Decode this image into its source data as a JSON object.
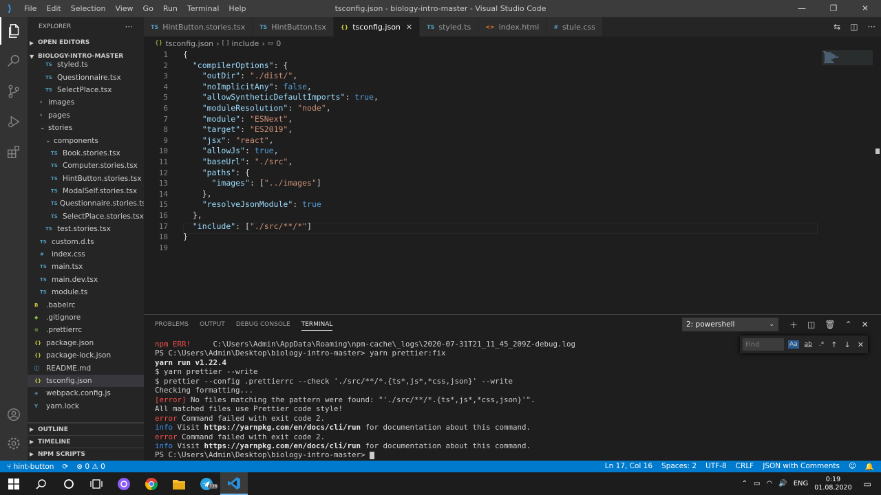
{
  "titlebar": {
    "menus": [
      "File",
      "Edit",
      "Selection",
      "View",
      "Go",
      "Run",
      "Terminal",
      "Help"
    ],
    "title": "tsconfig.json - biology-intro-master - Visual Studio Code"
  },
  "explorer": {
    "header": "EXPLORER",
    "open_editors": "OPEN EDITORS",
    "root": "BIOLOGY-INTRO-MASTER",
    "items": [
      {
        "label": "styled.ts",
        "type": "ts",
        "indent": 2
      },
      {
        "label": "Questionnaire.tsx",
        "type": "ts",
        "indent": 2
      },
      {
        "label": "SelectPlace.tsx",
        "type": "ts",
        "indent": 2
      },
      {
        "label": "images",
        "type": "folder",
        "indent": 1
      },
      {
        "label": "pages",
        "type": "folder",
        "indent": 1
      },
      {
        "label": "stories",
        "type": "folder-open",
        "indent": 1
      },
      {
        "label": "components",
        "type": "folder-open",
        "indent": 2
      },
      {
        "label": "Book.stories.tsx",
        "type": "ts",
        "indent": 3
      },
      {
        "label": "Computer.stories.tsx",
        "type": "ts",
        "indent": 3
      },
      {
        "label": "HintButton.stories.tsx",
        "type": "ts",
        "indent": 3
      },
      {
        "label": "ModalSelf.stories.tsx",
        "type": "ts",
        "indent": 3
      },
      {
        "label": "Questionnaire.stories.tsx",
        "type": "ts",
        "indent": 3
      },
      {
        "label": "SelectPlace.stories.tsx",
        "type": "ts",
        "indent": 3
      },
      {
        "label": "test.stories.tsx",
        "type": "ts",
        "indent": 2
      },
      {
        "label": "custom.d.ts",
        "type": "ts",
        "indent": 1
      },
      {
        "label": "index.css",
        "type": "css",
        "indent": 1
      },
      {
        "label": "main.tsx",
        "type": "ts",
        "indent": 1
      },
      {
        "label": "main.dev.tsx",
        "type": "ts",
        "indent": 1
      },
      {
        "label": "module.ts",
        "type": "ts",
        "indent": 1
      },
      {
        "label": ".babelrc",
        "type": "babel",
        "indent": 0
      },
      {
        "label": ".gitignore",
        "type": "git",
        "indent": 0
      },
      {
        "label": ".prettierrc",
        "type": "prettier",
        "indent": 0
      },
      {
        "label": "package.json",
        "type": "json",
        "indent": 0
      },
      {
        "label": "package-lock.json",
        "type": "json",
        "indent": 0
      },
      {
        "label": "README.md",
        "type": "md",
        "indent": 0
      },
      {
        "label": "tsconfig.json",
        "type": "json",
        "indent": 0,
        "selected": true
      },
      {
        "label": "webpack.config.js",
        "type": "webpack",
        "indent": 0
      },
      {
        "label": "yarn.lock",
        "type": "yarn",
        "indent": 0
      }
    ],
    "outline": "OUTLINE",
    "timeline": "TIMELINE",
    "npm_scripts": "NPM SCRIPTS"
  },
  "tabs": [
    {
      "label": "HintButton.stories.tsx",
      "icon": "TS",
      "active": false
    },
    {
      "label": "HintButton.tsx",
      "icon": "TS",
      "active": false
    },
    {
      "label": "tsconfig.json",
      "icon": "{}",
      "active": true
    },
    {
      "label": "styled.ts",
      "icon": "TS",
      "active": false
    },
    {
      "label": "index.html",
      "icon": "<>",
      "active": false
    },
    {
      "label": "stule.css",
      "icon": "#",
      "active": false
    }
  ],
  "breadcrumb": {
    "file": "tsconfig.json",
    "seg1": "include",
    "seg2": "0"
  },
  "code_lines": [
    "{",
    "  \"compilerOptions\": {",
    "    \"outDir\": \"./dist/\",",
    "    \"noImplicitAny\": false,",
    "    \"allowSyntheticDefaultImports\": true,",
    "    \"moduleResolution\": \"node\",",
    "    \"module\": \"ESNext\",",
    "    \"target\": \"ES2019\",",
    "    \"jsx\": \"react\",",
    "    \"allowJs\": true,",
    "    \"baseUrl\": \"./src\",",
    "    \"paths\": {",
    "      \"images\": [\"../images\"]",
    "    },",
    "    \"resolveJsonModule\": true",
    "  },",
    "  \"include\": [\"./src/**/*\"]",
    "}",
    ""
  ],
  "panel": {
    "tabs": [
      "PROBLEMS",
      "OUTPUT",
      "DEBUG CONSOLE",
      "TERMINAL"
    ],
    "shell": "2: powershell",
    "find_placeholder": "Find",
    "terminal": [
      [
        [
          "red",
          "npm ERR!"
        ],
        [
          "",
          "     C:\\Users\\Admin\\AppData\\Roaming\\npm-cache\\_logs\\2020-07-31T21_11_45_209Z-debug.log"
        ]
      ],
      [
        [
          "",
          "PS C:\\Users\\Admin\\Desktop\\biology-intro-master> yarn prettier:fix"
        ]
      ],
      [
        [
          "bold",
          "yarn run v1.22.4"
        ]
      ],
      [
        [
          "",
          "$ yarn prettier --write"
        ]
      ],
      [
        [
          "",
          "$ prettier --config .prettierrc --check './src/**/*.{ts*,js*,*css,json}' --write"
        ]
      ],
      [
        [
          "",
          "Checking formatting..."
        ]
      ],
      [
        [
          "red",
          "[error]"
        ],
        [
          "",
          " No files matching the pattern were found: \"'./src/**/*.{ts*,js*,*css,json}'\"."
        ]
      ],
      [
        [
          "",
          "All matched files use Prettier code style!"
        ]
      ],
      [
        [
          "red",
          "error"
        ],
        [
          "",
          " Command failed with exit code 2."
        ]
      ],
      [
        [
          "blue",
          "info"
        ],
        [
          "",
          " Visit "
        ],
        [
          "bold",
          "https://yarnpkg.com/en/docs/cli/run"
        ],
        [
          "",
          " for documentation about this command."
        ]
      ],
      [
        [
          "red",
          "error"
        ],
        [
          "",
          " Command failed with exit code 2."
        ]
      ],
      [
        [
          "blue",
          "info"
        ],
        [
          "",
          " Visit "
        ],
        [
          "bold",
          "https://yarnpkg.com/en/docs/cli/run"
        ],
        [
          "",
          " for documentation about this command."
        ]
      ],
      [
        [
          "",
          "PS C:\\Users\\Admin\\Desktop\\biology-intro-master> "
        ]
      ]
    ]
  },
  "status": {
    "branch": "hint-button",
    "problems": "⊗ 0 ⚠ 0",
    "position": "Ln 17, Col 16",
    "spaces": "Spaces: 2",
    "encoding": "UTF-8",
    "eol": "CRLF",
    "language": "JSON with Comments"
  },
  "taskbar": {
    "lang": "ENG",
    "time": "0:19",
    "date": "01.08.2020",
    "telegram_badge": "336"
  }
}
